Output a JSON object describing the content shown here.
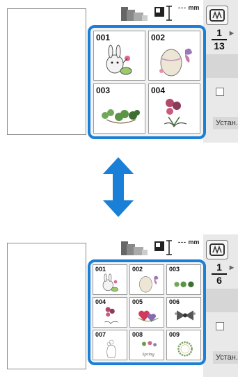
{
  "top": {
    "measure": {
      "width_value": "---",
      "unit": "mm"
    },
    "page": {
      "current": "1",
      "total": "13"
    },
    "side_label": "Устан.",
    "designs": [
      {
        "id": "001",
        "icon": "bunny-design"
      },
      {
        "id": "002",
        "icon": "egg-butterfly-design"
      },
      {
        "id": "003",
        "icon": "clover-design"
      },
      {
        "id": "004",
        "icon": "flower-bouquet-design"
      }
    ]
  },
  "transition_icon": "double-arrow-vertical",
  "bottom": {
    "measure": {
      "width_value": "---",
      "unit": "mm"
    },
    "page": {
      "current": "1",
      "total": "6"
    },
    "side_label": "Устан.",
    "designs": [
      {
        "id": "001",
        "icon": "bunny-design"
      },
      {
        "id": "002",
        "icon": "egg-butterfly-design"
      },
      {
        "id": "003",
        "icon": "clover-design"
      },
      {
        "id": "004",
        "icon": "flower-bouquet-design"
      },
      {
        "id": "005",
        "icon": "hearts-design"
      },
      {
        "id": "006",
        "icon": "bow-design"
      },
      {
        "id": "007",
        "icon": "vase-design"
      },
      {
        "id": "008",
        "icon": "spring-text-design"
      },
      {
        "id": "009",
        "icon": "wreath-design"
      }
    ],
    "spring_text": "Spring"
  },
  "colors": {
    "highlight": "#1a7fd6"
  }
}
